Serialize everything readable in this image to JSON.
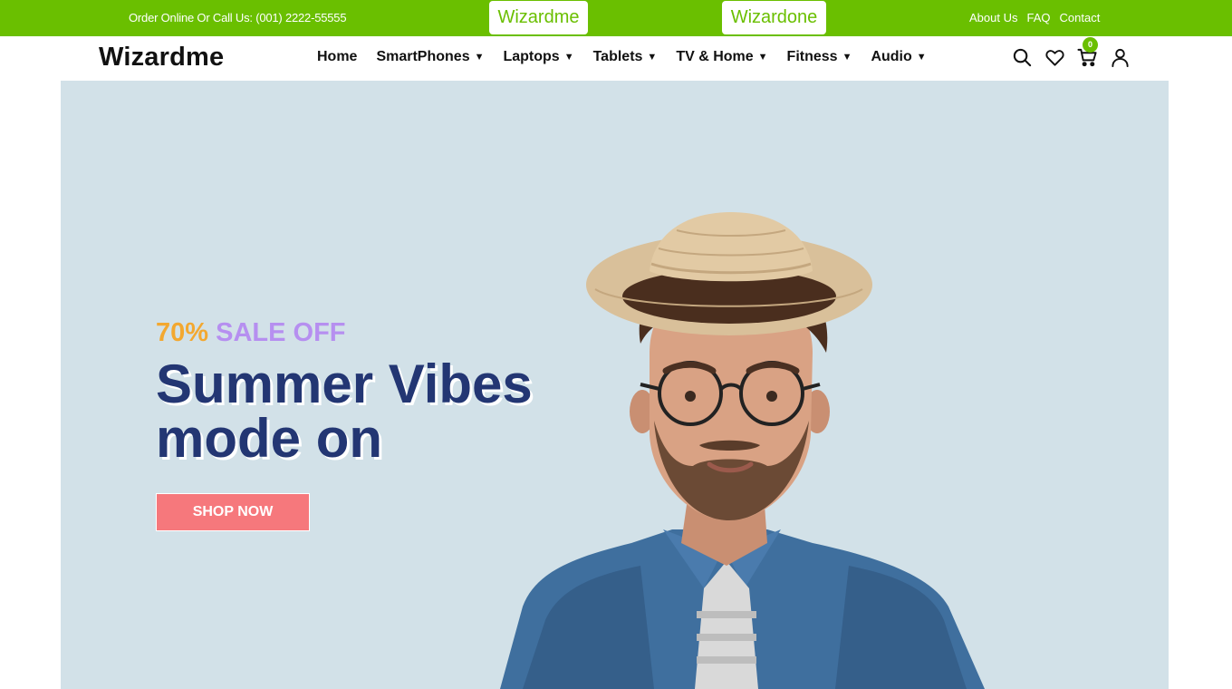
{
  "topbar": {
    "contact_text": "Order Online Or Call Us: (001) 2222-55555",
    "brand_one": "Wizardme",
    "brand_two": "Wizardone",
    "links": [
      "About Us",
      "FAQ",
      "Contact"
    ]
  },
  "nav": {
    "logo": "Wizardme",
    "menu": [
      {
        "label": "Home",
        "has_dropdown": false
      },
      {
        "label": "SmartPhones",
        "has_dropdown": true
      },
      {
        "label": "Laptops",
        "has_dropdown": true
      },
      {
        "label": "Tablets",
        "has_dropdown": true
      },
      {
        "label": "TV & Home",
        "has_dropdown": true
      },
      {
        "label": "Fitness",
        "has_dropdown": true
      },
      {
        "label": "Audio",
        "has_dropdown": true
      }
    ],
    "caret": "▼",
    "icons": [
      "search-icon",
      "heart-icon",
      "cart-icon",
      "user-icon"
    ],
    "cart_count": "0"
  },
  "hero": {
    "sale_percent": "70%",
    "sale_text": "SALE OFF",
    "headline_line1": "Summer Vibes",
    "headline_line2": "mode on",
    "button_label": "SHOP NOW"
  },
  "colors": {
    "brand_green": "#6abf00",
    "hero_bg": "#d2e1e8",
    "headline": "#233673",
    "sale_percent": "#f3a830",
    "sale_text": "#b68ff0",
    "button": "#f6787c"
  }
}
